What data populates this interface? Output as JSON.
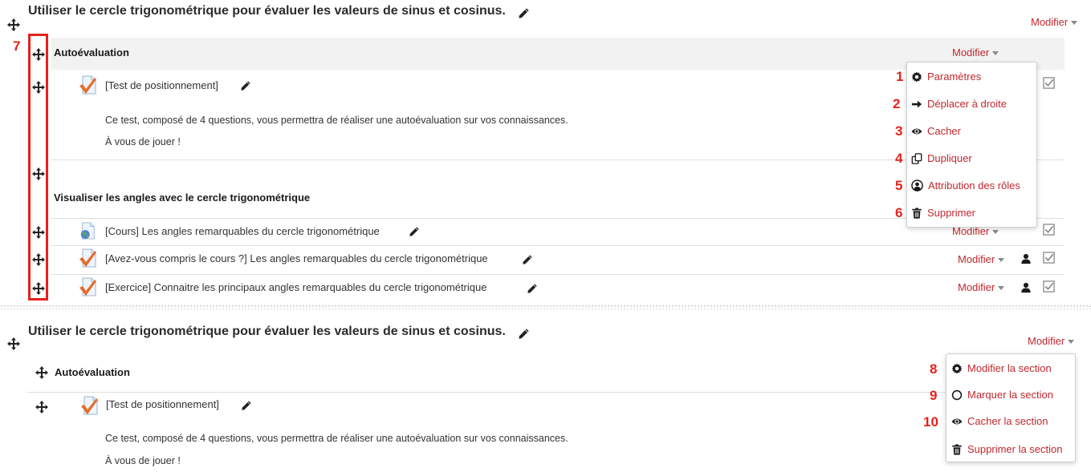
{
  "top": {
    "section_title": "Utiliser le cercle trigonométrique pour évaluer les valeurs de sinus et cosinus.",
    "modifier_label": "Modifier",
    "callout_number": "7",
    "sub_section": {
      "title": "Autoévaluation",
      "modifier_label": "Modifier"
    },
    "activity_test": {
      "title": "[Test de positionnement]",
      "description": "Ce test, composé de 4 questions, vous permettra de réaliser une autoévaluation sur vos connaissances.",
      "note": "À vous de jouer !"
    },
    "sub_section2": {
      "title": "Visualiser les angles avec le cercle trigonométrique"
    },
    "rows": [
      {
        "title": "[Cours] Les angles remarquables du cercle trigonométrique",
        "modifier_label": "Modifier",
        "icon": "resource-globe-icon"
      },
      {
        "title": "[Avez-vous compris le cours ?] Les angles remarquables du cercle trigonométrique",
        "modifier_label": "Modifier",
        "icon": "quiz-check-icon"
      },
      {
        "title": "[Exercice] Connaitre les principaux angles remarquables du cercle trigonométrique",
        "modifier_label": "Modifier",
        "icon": "quiz-check-icon"
      }
    ],
    "activity_menu": {
      "items": [
        {
          "number": "1",
          "label": "Paramètres",
          "icon": "gear-icon"
        },
        {
          "number": "2",
          "label": "Déplacer à droite",
          "icon": "arrow-right-icon"
        },
        {
          "number": "3",
          "label": "Cacher",
          "icon": "eye-icon"
        },
        {
          "number": "4",
          "label": "Dupliquer",
          "icon": "duplicate-icon"
        },
        {
          "number": "5",
          "label": "Attribution des rôles",
          "icon": "user-circle-icon"
        },
        {
          "number": "6",
          "label": "Supprimer",
          "icon": "trash-icon"
        }
      ]
    }
  },
  "bottom": {
    "section_title": "Utiliser le cercle trigonométrique pour évaluer les valeurs de sinus et cosinus.",
    "modifier_label": "Modifier",
    "sub_section": {
      "title": "Autoévaluation"
    },
    "activity_test": {
      "title": "[Test de positionnement]",
      "description": "Ce test, composé de 4 questions, vous permettra de réaliser une autoévaluation sur vos connaissances.",
      "note": "À vous de jouer !"
    },
    "section_menu": {
      "items": [
        {
          "number": "8",
          "label": "Modifier la section",
          "icon": "gear-icon"
        },
        {
          "number": "9",
          "label": "Marquer la section",
          "icon": "circle-icon"
        },
        {
          "number": "10",
          "label": "Cacher la section",
          "icon": "eye-icon"
        },
        {
          "number": "",
          "label": "Supprimer la section",
          "icon": "trash-icon"
        }
      ]
    }
  },
  "colors": {
    "accent": "#c0282f",
    "callout": "#e8201a",
    "highlight_box": "#e8201a",
    "row_header_bg": "#f2f2f2"
  }
}
